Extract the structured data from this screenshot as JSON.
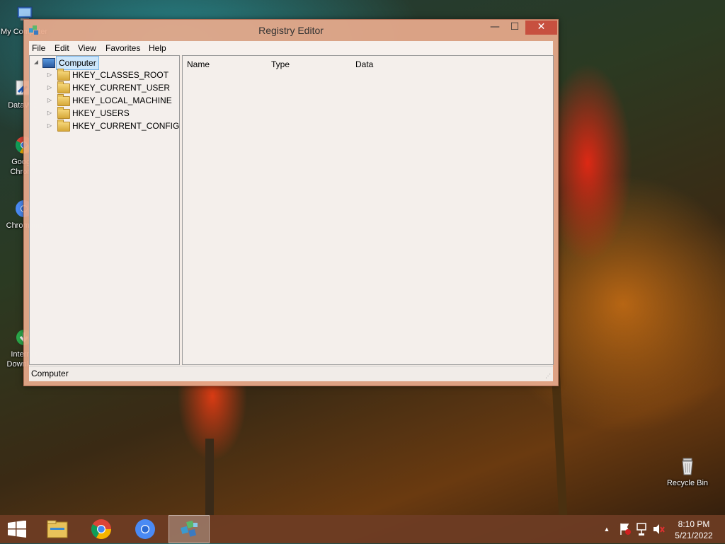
{
  "desktop": {
    "icons": [
      {
        "label": "My Computer",
        "icon": "computer-icon"
      },
      {
        "label": "DataWiz",
        "icon": "shortcut-icon"
      },
      {
        "label": "Google Chrome",
        "icon": "chrome-icon"
      },
      {
        "label": "Chromium",
        "icon": "chromium-icon"
      },
      {
        "label": "Internet Download",
        "icon": "download-icon"
      },
      {
        "label": "Recycle Bin",
        "icon": "recycle-bin-icon"
      }
    ]
  },
  "window": {
    "title": "Registry Editor",
    "buttons": {
      "minimize": "—",
      "maximize": "☐",
      "close": "✕"
    },
    "menu": [
      "File",
      "Edit",
      "View",
      "Favorites",
      "Help"
    ],
    "tree": {
      "root": "Computer",
      "children": [
        "HKEY_CLASSES_ROOT",
        "HKEY_CURRENT_USER",
        "HKEY_LOCAL_MACHINE",
        "HKEY_USERS",
        "HKEY_CURRENT_CONFIG"
      ]
    },
    "columns": [
      "Name",
      "Type",
      "Data"
    ],
    "status": "Computer"
  },
  "taskbar": {
    "items": [
      "start-icon",
      "file-explorer-icon",
      "chrome-icon",
      "chromium-icon",
      "registry-editor-icon"
    ],
    "tray": [
      "show-hidden-icons",
      "action-center-flag-icon",
      "network-icon",
      "volume-muted-icon"
    ],
    "time": "8:10 PM",
    "date": "5/21/2022"
  },
  "colors": {
    "window_frame": "#e8aa8c",
    "close_button": "#c7503f",
    "taskbar": "#6e3c23"
  }
}
